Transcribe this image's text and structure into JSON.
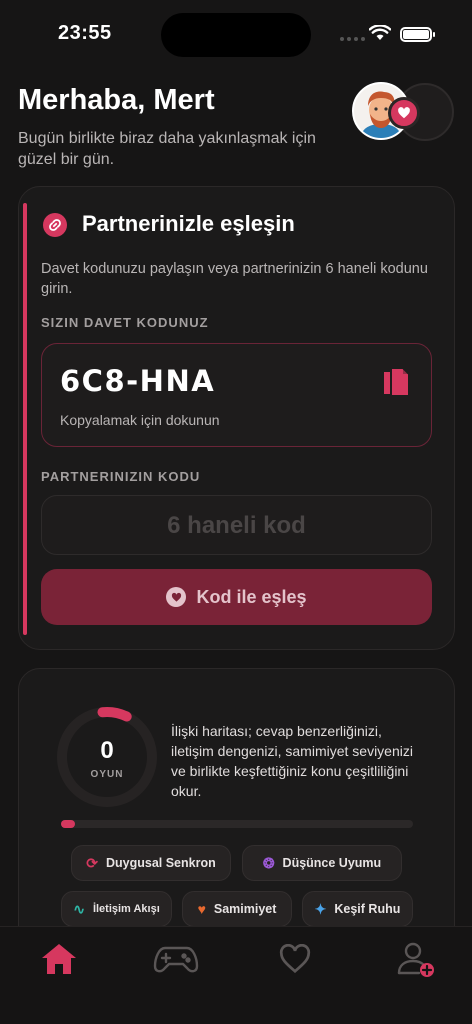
{
  "status_bar": {
    "time": "23:55"
  },
  "header": {
    "greeting": "Merhaba, Mert",
    "subtitle": "Bugün birlikte biraz daha yakınlaşmak için güzel bir gün."
  },
  "pair_card": {
    "title": "Partnerinizle eşleşin",
    "description": "Davet kodunuzu paylaşın veya partnerinizin 6 haneli kodunu girin.",
    "your_code_label": "SIZIN DAVET KODUNUZ",
    "your_code": "6C8-HNA",
    "copy_hint": "Kopyalamak için dokunun",
    "partner_code_label": "PARTNERINIZIN KODU",
    "partner_code_placeholder": "6 haneli kod",
    "match_button": "Kod ile eşleş"
  },
  "stats_card": {
    "game_count": "0",
    "game_label": "OYUN",
    "description": "İlişki haritası; cevap benzerliğinizi, iletişim dengenizi, samimiyet seviyenizi ve birlikte keşfettiğiniz konu çeşitliliğini okur.",
    "progress_percent": 4,
    "chips": [
      {
        "label": "Duygusal Senkron",
        "icon": "sync-icon",
        "color": "#d6385f"
      },
      {
        "label": "Düşünce Uyumu",
        "icon": "brain-icon",
        "color": "#9b59d6"
      },
      {
        "label": "İletişim Akışı",
        "icon": "pulse-icon",
        "color": "#2fb6a6"
      },
      {
        "label": "Samimiyet",
        "icon": "heart-icon",
        "color": "#e8692f"
      },
      {
        "label": "Keşif Ruhu",
        "icon": "sparkle-icon",
        "color": "#4aa3e8"
      }
    ]
  },
  "tab_bar": {
    "tabs": [
      {
        "icon": "home-icon",
        "active": true
      },
      {
        "icon": "gamepad-icon",
        "active": false
      },
      {
        "icon": "heart-icon",
        "active": false
      },
      {
        "icon": "add-user-icon",
        "active": false
      }
    ]
  },
  "colors": {
    "accent": "#d6385f",
    "background": "#161515",
    "card": "#1b1a1a"
  }
}
